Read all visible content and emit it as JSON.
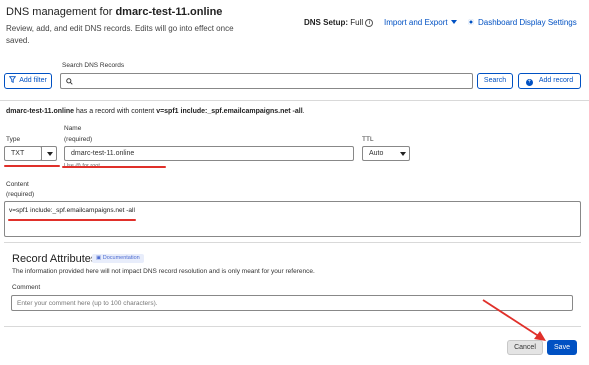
{
  "header": {
    "title_prefix": "DNS management for ",
    "title_domain": "dmarc-test-11.online",
    "subtitle": "Review, add, and edit DNS records. Edits will go into effect once saved.",
    "dns_setup_label": "DNS Setup:",
    "dns_setup_value": "Full",
    "import_export": "Import and Export",
    "dashboard_settings": "Dashboard Display Settings"
  },
  "search": {
    "label": "Search DNS Records",
    "placeholder": "",
    "filter_button": "Add filter",
    "search_button": "Search",
    "add_record_button": "Add record"
  },
  "record": {
    "message_domain": "dmarc-test-11.online",
    "message_middle": " has a record with content ",
    "message_content": "v=spf1 include:_spf.emailcampaigns.net -all",
    "message_end": ".",
    "type_label": "Type",
    "type_value": "TXT",
    "name_label": "Name",
    "name_required": "(required)",
    "name_value": "dmarc-test-11.online",
    "name_hint": "Use @ for root",
    "ttl_label": "TTL",
    "ttl_value": "Auto",
    "content_label": "Content",
    "content_required": "(required)",
    "content_value": "v=spf1 include:_spf.emailcampaigns.net -all"
  },
  "attributes": {
    "title": "Record Attributes",
    "doc_badge": "Documentation",
    "description": "The information provided here will not impact DNS record resolution and is only meant for your reference.",
    "comment_label": "Comment",
    "comment_placeholder": "Enter your comment here (up to 100 characters)."
  },
  "actions": {
    "cancel": "Cancel",
    "save": "Save"
  },
  "colors": {
    "accent": "#0051c3",
    "annotation": "#e0302a"
  }
}
